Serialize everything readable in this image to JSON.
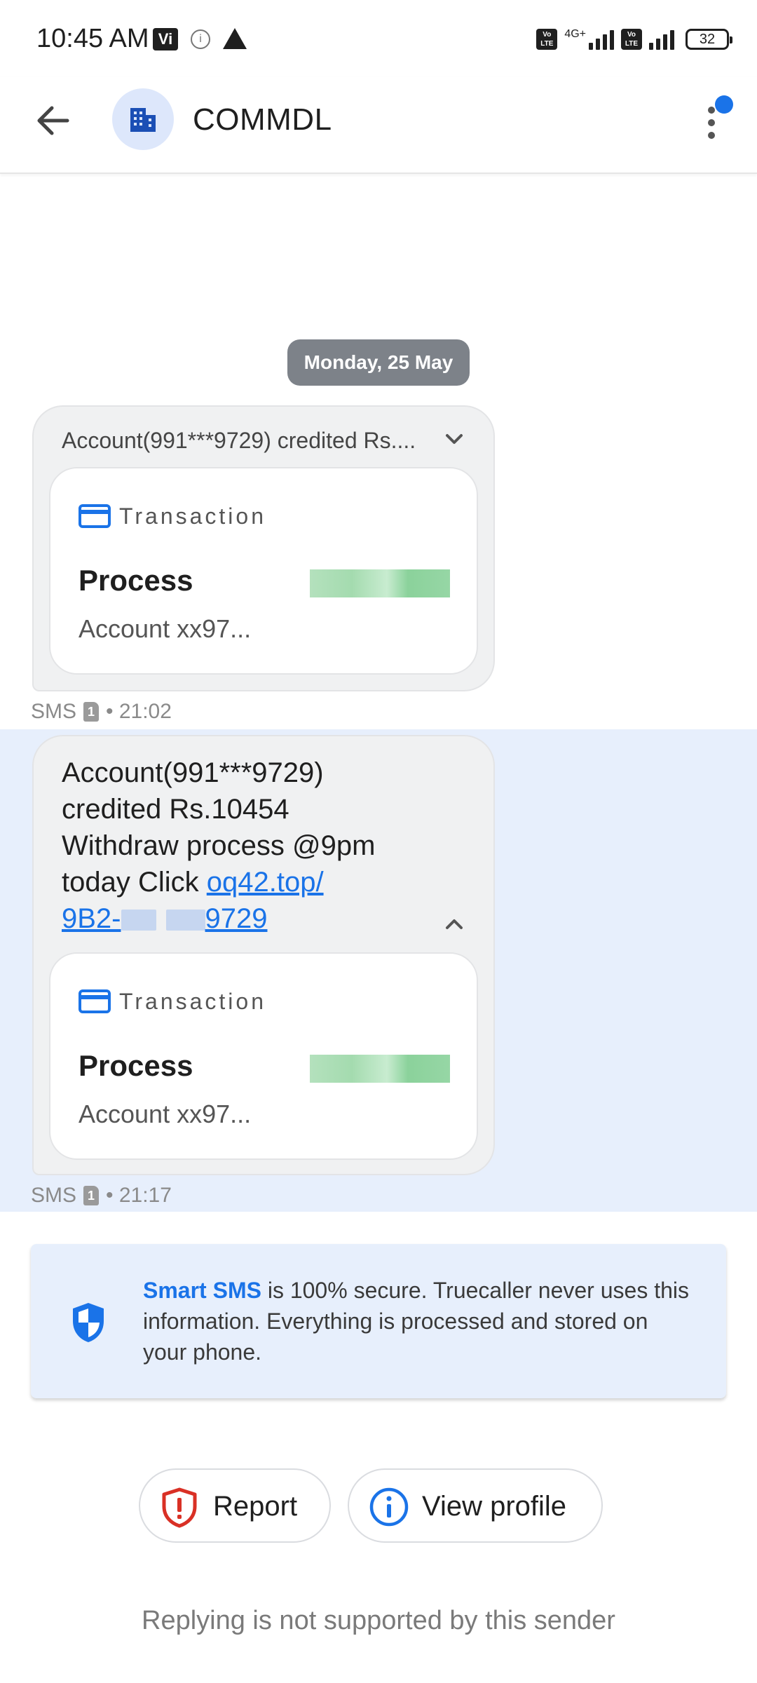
{
  "status_bar": {
    "time": "10:45 AM",
    "carrier_badge": "Vi",
    "network": "4G+",
    "volte_label": "Vo LTE",
    "battery": "32"
  },
  "header": {
    "title": "COMMDL",
    "avatar_icon": "building-icon"
  },
  "conversation": {
    "date_chip": "Monday, 25 May",
    "messages": [
      {
        "preview": "Account(991***9729) credited Rs....",
        "card_label": "Transaction",
        "card_title": "Process",
        "card_subtitle": "Account xx97...",
        "meta_channel": "SMS",
        "meta_sim": "1",
        "meta_time": "• 21:02"
      },
      {
        "body_line1": "Account(991***9729)",
        "body_line2": "credited Rs.10454",
        "body_line3": "Withdraw process @9pm",
        "body_line4_prefix": "today Click ",
        "link_part1": "oq42.top/",
        "link_part2_start": "9B2-",
        "link_part2_end": "9729",
        "card_label": "Transaction",
        "card_title": "Process",
        "card_subtitle": "Account xx97...",
        "meta_channel": "SMS",
        "meta_sim": "1",
        "meta_time": "• 21:17"
      }
    ]
  },
  "info_banner": {
    "brand": "Smart SMS",
    "text": " is 100% secure. Truecaller never uses this information. Everything is processed and stored on your phone."
  },
  "actions": {
    "report_label": "Report",
    "profile_label": "View profile"
  },
  "footer": {
    "note": "Replying is not supported by this sender"
  },
  "colors": {
    "accent": "#1a73e8",
    "selected_band": "#e7effc",
    "report_red": "#d93025",
    "date_chip": "#7d8289"
  }
}
